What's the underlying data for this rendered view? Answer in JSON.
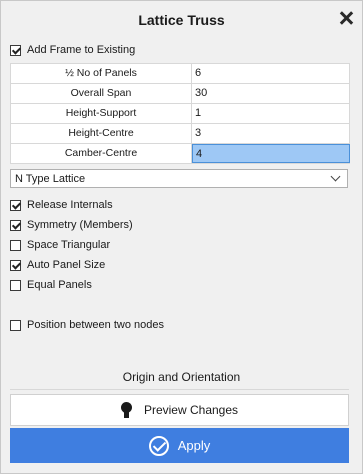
{
  "header": {
    "title": "Lattice Truss"
  },
  "add_frame": {
    "label": "Add Frame to Existing",
    "checked": true
  },
  "grid": [
    {
      "label": "½ No of Panels",
      "value": "6",
      "selected": false
    },
    {
      "label": "Overall Span",
      "value": "30",
      "selected": false
    },
    {
      "label": "Height-Support",
      "value": "1",
      "selected": false
    },
    {
      "label": "Height-Centre",
      "value": "3",
      "selected": false
    },
    {
      "label": "Camber-Centre",
      "value": "4",
      "selected": true
    }
  ],
  "lattice_type": {
    "selected": "N Type Lattice"
  },
  "options": [
    {
      "label": "Release Internals",
      "checked": true
    },
    {
      "label": "Symmetry (Members)",
      "checked": true
    },
    {
      "label": "Space Triangular",
      "checked": false
    },
    {
      "label": "Auto Panel Size",
      "checked": true
    },
    {
      "label": "Equal Panels",
      "checked": false
    }
  ],
  "position_between": {
    "label": "Position between two nodes",
    "checked": false
  },
  "origin": {
    "label": "Origin and Orientation"
  },
  "preview": {
    "label": "Preview Changes"
  },
  "apply": {
    "label": "Apply"
  },
  "colors": {
    "accent": "#3f7ee0",
    "selection": "#9ec8f5"
  },
  "icons": {
    "close": "close-icon",
    "bulb": "lightbulb-icon",
    "apply": "check-circle-icon",
    "dropdown": "chevron-down-icon"
  }
}
